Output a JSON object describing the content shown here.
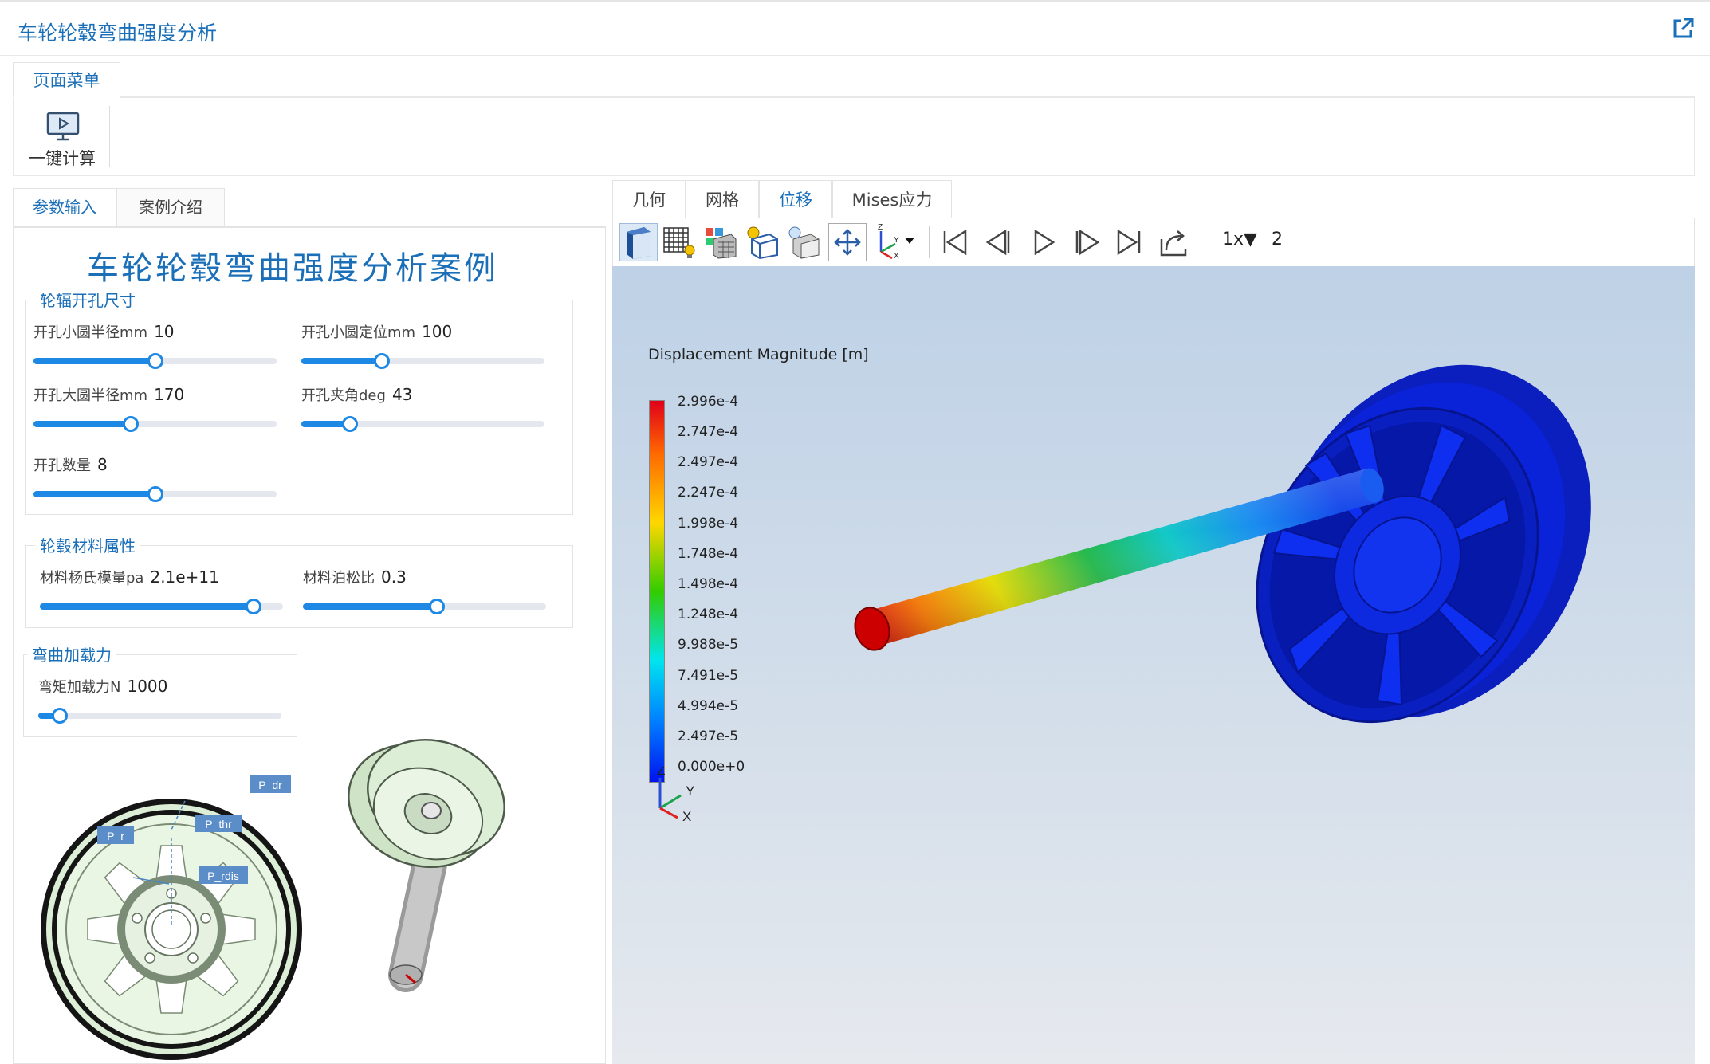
{
  "app": {
    "title": "车轮轮毂弯曲强度分析"
  },
  "menu": {
    "tab_label": "页面菜单",
    "calc_button": "一键计算"
  },
  "left_tabs": [
    "参数输入",
    "案例介绍"
  ],
  "case_title": "车轮轮毂弯曲强度分析案例",
  "groups": {
    "holes": {
      "title": "轮辐开孔尺寸",
      "fields": [
        {
          "label": "开孔小圆半径mm",
          "value": "10",
          "level": 0.5
        },
        {
          "label": "开孔小圆定位mm",
          "value": "100",
          "level": 0.33
        },
        {
          "label": "开孔大圆半径mm",
          "value": "170",
          "level": 0.4
        },
        {
          "label": "开孔夹角deg",
          "value": "43",
          "level": 0.2
        },
        {
          "label": "开孔数量",
          "value": "8",
          "level": 0.5
        }
      ]
    },
    "material": {
      "title": "轮毂材料属性",
      "fields": [
        {
          "label": "材料杨氏模量pa",
          "value": "2.1e+11",
          "level": 0.88
        },
        {
          "label": "材料泊松比",
          "value": "0.3",
          "level": 0.55
        }
      ]
    },
    "load": {
      "title": "弯曲加载力",
      "fields": [
        {
          "label": "弯矩加载力N",
          "value": "1000",
          "level": 0.09
        }
      ]
    }
  },
  "sketch_labels": {
    "dr": "P_dr",
    "thr": "P_thr",
    "r": "P_r",
    "rdis": "P_rdis"
  },
  "result_tabs": [
    "几何",
    "网格",
    "位移",
    "Mises应力"
  ],
  "active_result_tab": "位移",
  "toolbar": {
    "speed": "1x",
    "frame": "2"
  },
  "legend": {
    "title": "Displacement Magnitude [m]",
    "ticks": [
      "2.996e-4",
      "2.747e-4",
      "2.497e-4",
      "2.247e-4",
      "1.998e-4",
      "1.748e-4",
      "1.498e-4",
      "1.248e-4",
      "9.988e-5",
      "7.491e-5",
      "4.994e-5",
      "2.497e-5",
      "0.000e+0"
    ]
  },
  "triad": {
    "z": "Z",
    "y": "Y",
    "x": "X"
  },
  "colors": {
    "accent": "#1a6fb8",
    "slider": "#1e88e5",
    "rim_blue": "#0a1fd6"
  }
}
